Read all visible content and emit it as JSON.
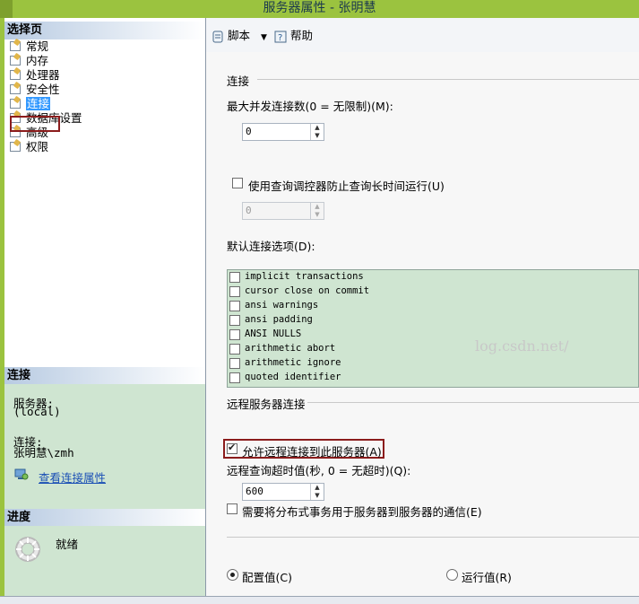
{
  "window": {
    "title": "服务器属性 - 张明慧"
  },
  "left_panel": {
    "select_page_header": "选择页",
    "pages": [
      {
        "label": "常规"
      },
      {
        "label": "内存"
      },
      {
        "label": "处理器"
      },
      {
        "label": "安全性"
      },
      {
        "label": "连接",
        "selected": true
      },
      {
        "label": "数据库设置"
      },
      {
        "label": "高级"
      },
      {
        "label": "权限"
      }
    ],
    "connection_header": "连接",
    "server_label": "服务器:",
    "server_value": "(local)",
    "conn_label": "连接:",
    "conn_value": "张明慧\\zmh",
    "view_conn_link": "查看连接属性",
    "progress_header": "进度",
    "progress_status": "就绪"
  },
  "toolbar": {
    "script_label": "脚本",
    "help_label": "帮助"
  },
  "connections": {
    "section_title": "连接",
    "max_conn_label": "最大并发连接数(0 = 无限制)(M):",
    "max_conn_value": "0",
    "governor_label": "使用查询调控器防止查询长时间运行(U)",
    "governor_checked": false,
    "governor_value": "0",
    "default_options_label": "默认连接选项(D):",
    "options": [
      {
        "label": "implicit transactions",
        "checked": false
      },
      {
        "label": "cursor close on commit",
        "checked": false
      },
      {
        "label": "ansi warnings",
        "checked": false
      },
      {
        "label": "ansi padding",
        "checked": false
      },
      {
        "label": "ANSI NULLS",
        "checked": false
      },
      {
        "label": "arithmetic abort",
        "checked": false
      },
      {
        "label": "arithmetic ignore",
        "checked": false
      },
      {
        "label": "quoted identifier",
        "checked": false
      }
    ],
    "watermark": "log.csdn.net/"
  },
  "remote": {
    "section_title": "远程服务器连接",
    "allow_remote_label": "允许远程连接到此服务器(A)",
    "allow_remote_checked": true,
    "timeout_label": "远程查询超时值(秒, 0 = 无超时)(Q):",
    "timeout_value": "600",
    "dist_tx_label": "需要将分布式事务用于服务器到服务器的通信(E)",
    "dist_tx_checked": false
  },
  "value_mode": {
    "configured_label": "配置值(C)",
    "running_label": "运行值(R)",
    "selected": "configured"
  },
  "colors": {
    "title_bar": "#9bc33f",
    "panel_green": "#cfe5d1",
    "highlight_border": "#8b1c1c",
    "selection": "#3399ff"
  }
}
